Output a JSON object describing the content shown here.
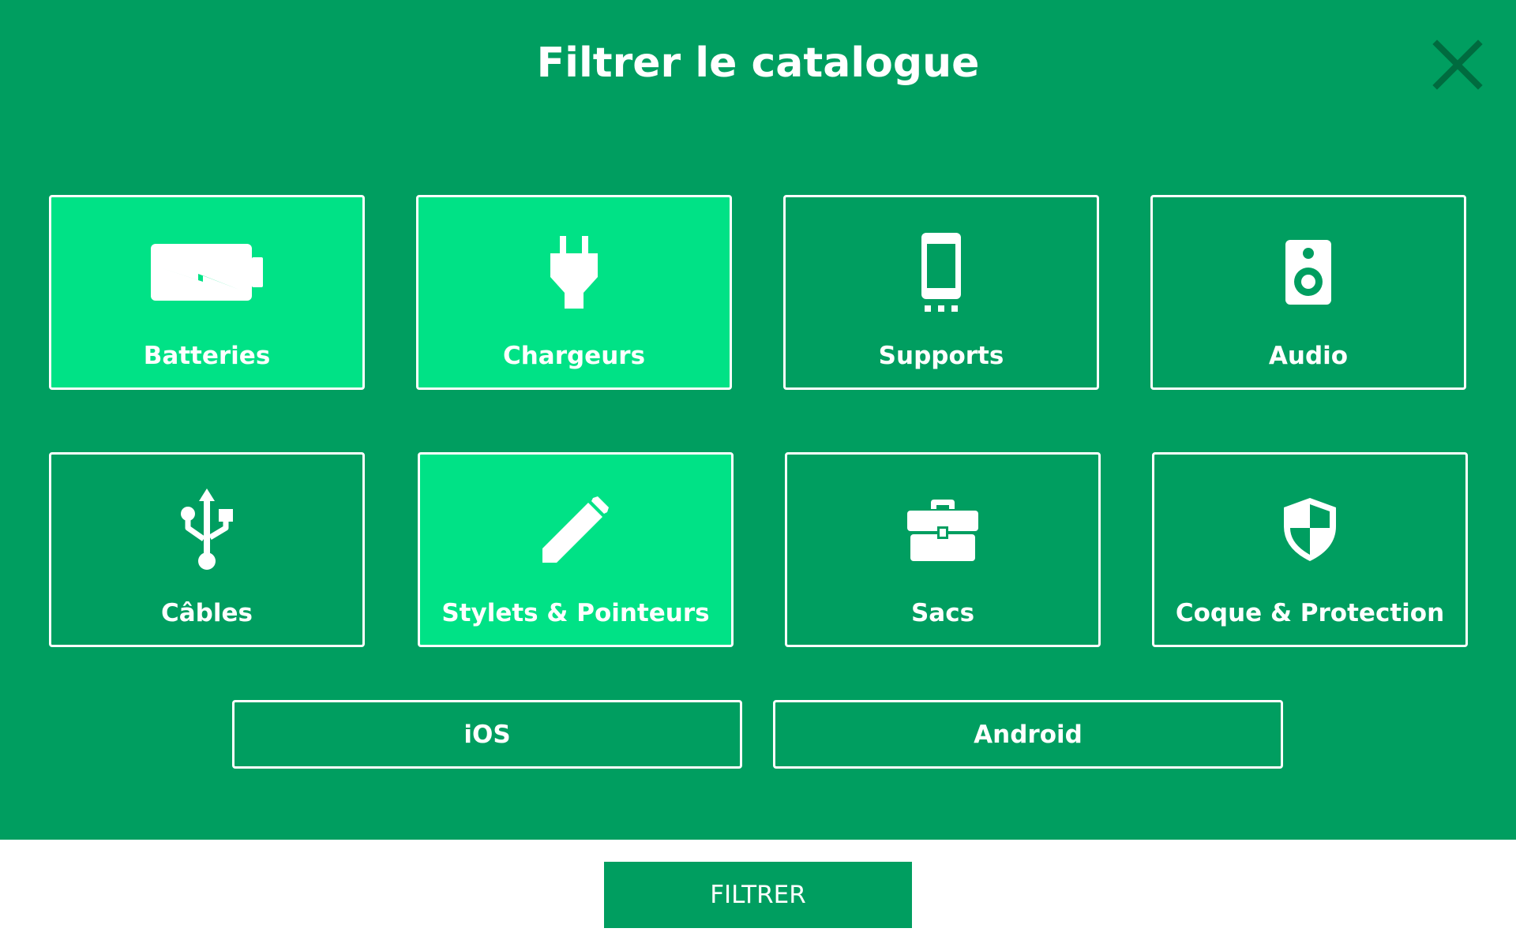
{
  "header": {
    "title": "Filtrer le catalogue",
    "close_icon": "close-icon"
  },
  "categories": [
    {
      "id": "batteries",
      "label": "Batteries",
      "icon": "battery-icon",
      "selected": true
    },
    {
      "id": "chargeurs",
      "label": "Chargeurs",
      "icon": "plug-icon",
      "selected": true
    },
    {
      "id": "supports",
      "label": "Supports",
      "icon": "phone-dock-icon",
      "selected": false
    },
    {
      "id": "audio",
      "label": "Audio",
      "icon": "speaker-icon",
      "selected": false
    },
    {
      "id": "cables",
      "label": "Câbles",
      "icon": "usb-icon",
      "selected": false
    },
    {
      "id": "stylets",
      "label": "Stylets & Pointeurs",
      "icon": "pencil-icon",
      "selected": true
    },
    {
      "id": "sacs",
      "label": "Sacs",
      "icon": "briefcase-icon",
      "selected": false
    },
    {
      "id": "coque",
      "label": "Coque & Protection",
      "icon": "shield-icon",
      "selected": false
    }
  ],
  "platforms": [
    {
      "id": "ios",
      "label": "iOS",
      "selected": false
    },
    {
      "id": "android",
      "label": "Android",
      "selected": false
    }
  ],
  "footer": {
    "filter_label": "FILTRER"
  },
  "colors": {
    "panel_background": "#009e60",
    "tile_selected": "#00e286",
    "close_icon": "#006b3f",
    "footer_background": "#ffffff"
  }
}
